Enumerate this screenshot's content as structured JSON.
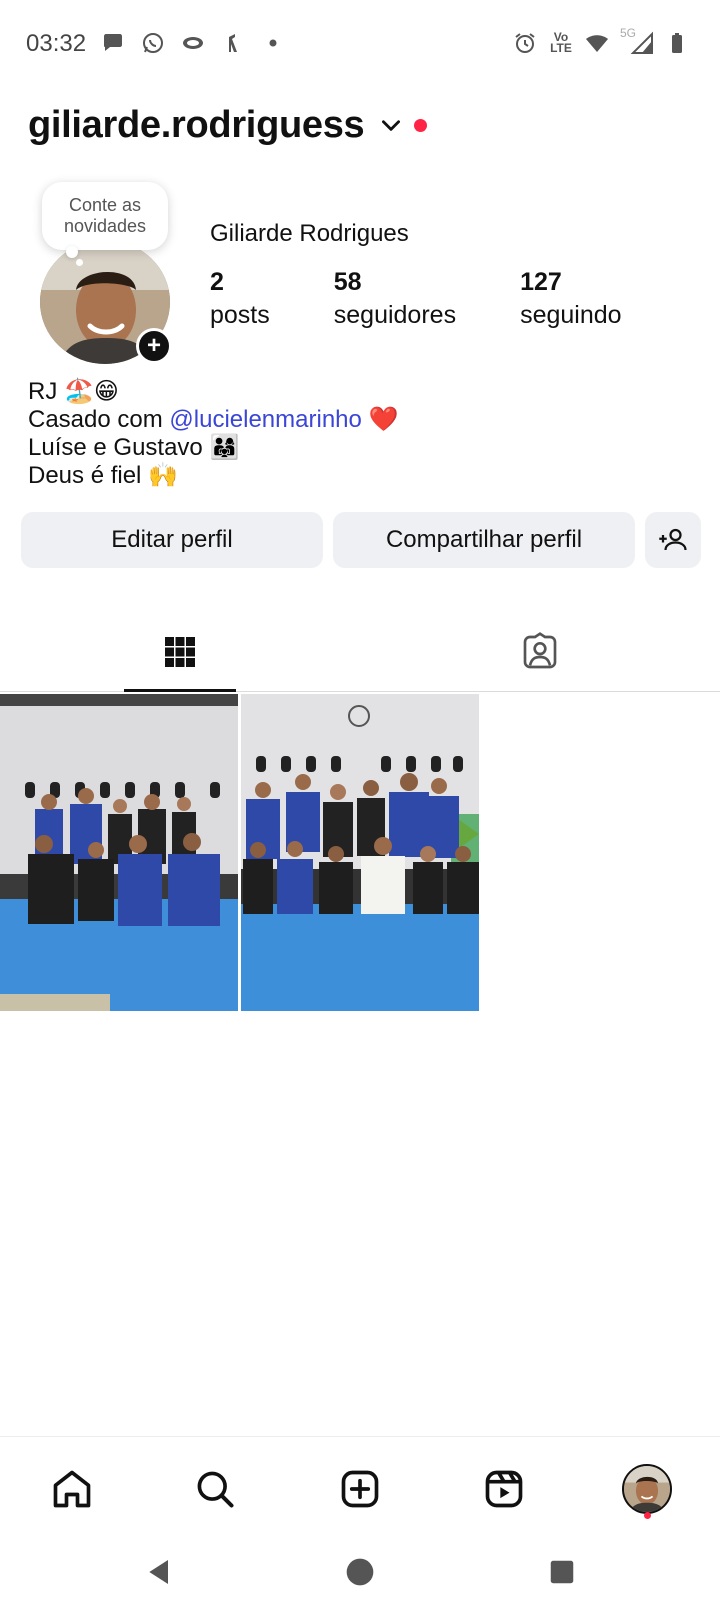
{
  "status_bar": {
    "time": "03:32",
    "network_label": "5G",
    "volte_label_1": "Vo",
    "volte_label_2": "LTE",
    "left_icons": [
      "message-icon",
      "whatsapp-icon",
      "eye-app-icon",
      "shoe-app-icon",
      "more-dot-icon"
    ],
    "right_icons": [
      "alarm-icon",
      "volte-icon",
      "wifi-icon",
      "signal-icon",
      "battery-icon"
    ]
  },
  "header": {
    "username": "giliarde.rodriguess",
    "notification_dot_color": "#ff2345"
  },
  "profile": {
    "note_text": "Conte as novidades",
    "display_name": "Giliarde Rodrigues",
    "stats": [
      {
        "value": "2",
        "label": "posts"
      },
      {
        "value": "58",
        "label": "seguidores"
      },
      {
        "value": "127",
        "label": "seguindo"
      }
    ],
    "bio": {
      "line1": "RJ 🏖️😁",
      "line2_prefix": "Casado com ",
      "line2_mention": "@lucielenmarinho",
      "line2_suffix": " ❤️",
      "line3": "Luíse e Gustavo 👨‍👩‍👧",
      "line4": "Deus é fiel 🙌"
    }
  },
  "actions": {
    "edit_label": "Editar perfil",
    "share_label": "Compartilhar perfil",
    "add_person_icon": "add-person-icon"
  },
  "tabs": {
    "items": [
      "grid-icon",
      "tagged-icon"
    ],
    "active": "grid-icon"
  },
  "posts": [
    {
      "name": "post-photo-1"
    },
    {
      "name": "post-photo-2"
    }
  ],
  "bottom_nav": {
    "items": [
      "home-icon",
      "search-icon",
      "create-icon",
      "reels-icon",
      "profile-avatar"
    ]
  },
  "colors": {
    "accent_mention": "#3b45d6",
    "button_bg": "#eff0f3",
    "notification": "#ff2345"
  }
}
